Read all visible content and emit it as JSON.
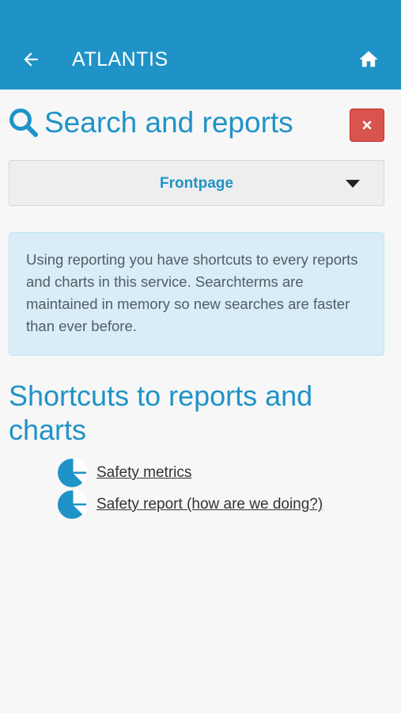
{
  "appbar": {
    "title": "ATLANTIS",
    "back_icon": "arrow-left-icon",
    "home_icon": "home-icon",
    "color": "#1f93c7"
  },
  "page": {
    "title": "Search and reports",
    "title_icon": "search-icon",
    "close_icon": "close-icon",
    "close_color": "#d9534f"
  },
  "selector": {
    "value": "Frontpage",
    "caret_icon": "caret-down-icon"
  },
  "info": {
    "text": "Using reporting you have shortcuts to every reports and charts in this service. Searchterms are maintained in memory so new searches are faster than ever before."
  },
  "shortcuts": {
    "heading": "Shortcuts to reports and charts",
    "items": [
      {
        "label": "Safety metrics",
        "icon": "pie-chart-icon"
      },
      {
        "label": "Safety report (how are we doing?)",
        "icon": "pie-chart-icon"
      }
    ]
  }
}
